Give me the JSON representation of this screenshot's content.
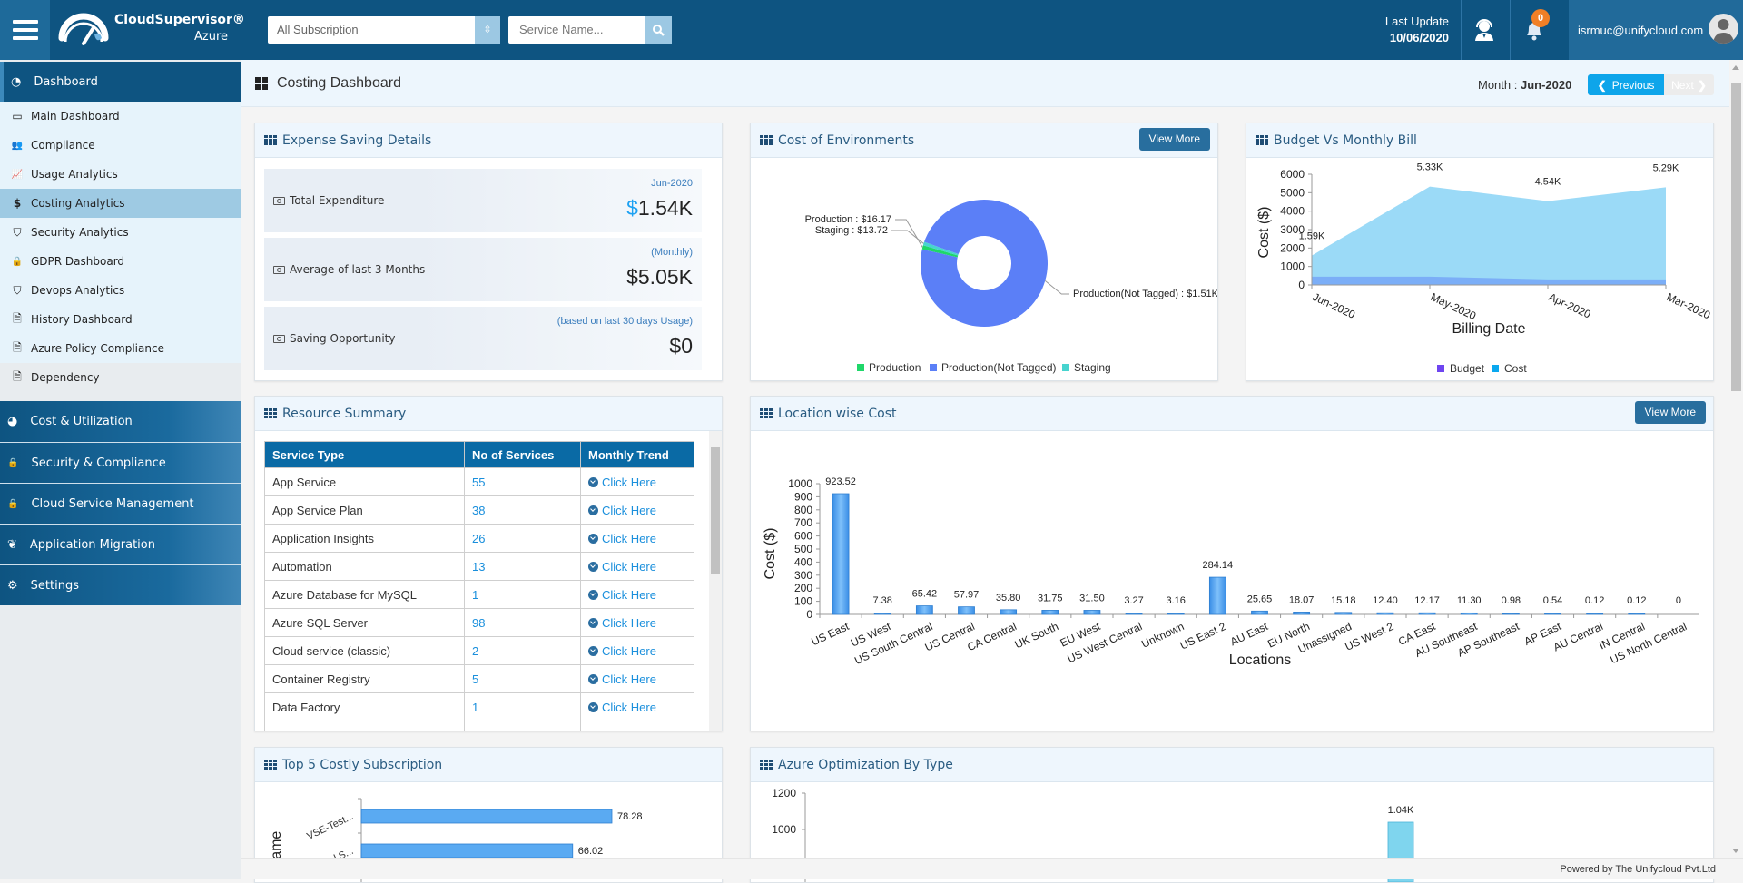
{
  "header": {
    "brand": "CloudSupervisor®",
    "brand_sub": "Azure",
    "subscription_select": "All Subscription",
    "service_search_placeholder": "Service Name...",
    "last_update_label": "Last Update",
    "last_update_value": "10/06/2020",
    "notification_count": "0",
    "user_email": "isrmuc@unifycloud.com"
  },
  "sidebar": {
    "dashboard_label": "Dashboard",
    "sub_items": [
      {
        "label": "Main Dashboard",
        "icon": "monitor-icon",
        "glyph": "▭",
        "active": false
      },
      {
        "label": "Compliance",
        "icon": "users-icon",
        "glyph": "👥",
        "active": false
      },
      {
        "label": "Usage Analytics",
        "icon": "line-chart-icon",
        "glyph": "📈",
        "active": false
      },
      {
        "label": "Costing Analytics",
        "icon": "dollar-icon",
        "glyph": "$",
        "active": true
      },
      {
        "label": "Security Analytics",
        "icon": "shield-icon",
        "glyph": "⛉",
        "active": false
      },
      {
        "label": "GDPR Dashboard",
        "icon": "lock-icon",
        "glyph": "🔒",
        "active": false
      },
      {
        "label": "Devops Analytics",
        "icon": "shield-icon",
        "glyph": "⛉",
        "active": false
      },
      {
        "label": "History Dashboard",
        "icon": "document-icon",
        "glyph": "🗎",
        "active": false
      },
      {
        "label": "Azure Policy Compliance",
        "icon": "document-icon",
        "glyph": "🗎",
        "active": false
      },
      {
        "label": "Dependency",
        "icon": "document-icon",
        "glyph": "🗎",
        "active": false
      }
    ],
    "main_items": [
      {
        "label": "Cost & Utilization",
        "icon": "pie-chart-icon",
        "glyph": "◕"
      },
      {
        "label": "Security & Compliance",
        "icon": "lock-icon",
        "glyph": "🔒"
      },
      {
        "label": "Cloud Service Management",
        "icon": "lock-icon",
        "glyph": "🔒"
      },
      {
        "label": "Application Migration",
        "icon": "leaf-icon",
        "glyph": "❦"
      },
      {
        "label": "Settings",
        "icon": "gear-icon",
        "glyph": "⚙"
      }
    ]
  },
  "page": {
    "title": "Costing Dashboard",
    "month_label": "Month : ",
    "month_value": "Jun-2020",
    "previous_label": "Previous",
    "next_label": "Next"
  },
  "expense": {
    "title": "Expense Saving Details",
    "rows": [
      {
        "label": "Total Expenditure",
        "sub": "Jun-2020",
        "currency": "$",
        "value": "1.54K"
      },
      {
        "label": "Average of last 3 Months",
        "sub": "(Monthly)",
        "currency": "$",
        "value": "5.05K"
      },
      {
        "label": "Saving Opportunity",
        "sub": "(based on last 30 days Usage)",
        "currency": "$",
        "value": "0"
      }
    ]
  },
  "resource_summary": {
    "title": "Resource Summary",
    "columns": [
      "Service Type",
      "No of Services",
      "Monthly Trend"
    ],
    "rows": [
      {
        "service": "App Service",
        "count": "55",
        "trend": "Click Here"
      },
      {
        "service": "App Service Plan",
        "count": "38",
        "trend": "Click Here"
      },
      {
        "service": "Application Insights",
        "count": "26",
        "trend": "Click Here"
      },
      {
        "service": "Automation",
        "count": "13",
        "trend": "Click Here"
      },
      {
        "service": "Azure Database for MySQL",
        "count": "1",
        "trend": "Click Here"
      },
      {
        "service": "Azure SQL Server",
        "count": "98",
        "trend": "Click Here"
      },
      {
        "service": "Cloud service (classic)",
        "count": "2",
        "trend": "Click Here"
      },
      {
        "service": "Container Registry",
        "count": "5",
        "trend": "Click Here"
      },
      {
        "service": "Data Factory",
        "count": "1",
        "trend": "Click Here"
      }
    ]
  },
  "panels": {
    "view_more_label": "View More",
    "top5_title": "Top 5 Costly Subscription",
    "optimization_title": "Azure Optimization By Type"
  },
  "footer": {
    "text": "Powered by The Unifycloud Pvt.Ltd"
  },
  "chart_data": [
    {
      "id": "cost_of_environments",
      "type": "pie",
      "title": "Cost of Environments",
      "labels": [
        "Production",
        "Production(Not Tagged)",
        "Staging"
      ],
      "values": [
        16.17,
        1510,
        13.72
      ],
      "data_labels": [
        "Production : $16.17",
        "Production(Not Tagged) : $1.51K",
        "Staging : $13.72"
      ],
      "colors": [
        "#1fd76a",
        "#5b7ff7",
        "#47d4cf"
      ],
      "donut": true,
      "legend": "bottom"
    },
    {
      "id": "budget_vs_monthly_bill",
      "type": "area",
      "title": "Budget Vs Monthly Bill",
      "categories": [
        "Jun-2020",
        "May-2020",
        "Apr-2020",
        "Mar-2020"
      ],
      "series": [
        {
          "name": "Budget",
          "values": [
            450,
            450,
            300,
            300
          ],
          "color": "#6e45f0"
        },
        {
          "name": "Cost",
          "values": [
            1590,
            5330,
            4540,
            5290
          ],
          "color": "#0aa8ef",
          "data_labels": [
            "1.59K",
            "5.33K",
            "4.54K",
            "5.29K"
          ]
        }
      ],
      "xlabel": "Billing Date",
      "ylabel": "Cost ($)",
      "ylim": [
        0,
        6000
      ],
      "yticks": [
        0,
        1000,
        2000,
        3000,
        4000,
        5000,
        6000
      ],
      "legend": "bottom"
    },
    {
      "id": "location_wise_cost",
      "type": "bar",
      "title": "Location wise Cost",
      "categories": [
        "US East",
        "US West",
        "US South Central",
        "US Central",
        "CA Central",
        "UK South",
        "EU West",
        "US West Central",
        "Unknown",
        "US East 2",
        "AU East",
        "EU North",
        "Unassigned",
        "US West 2",
        "CA East",
        "AU Southeast",
        "AP Southeast",
        "AP East",
        "AU Central",
        "IN Central",
        "US North Central"
      ],
      "values": [
        923.52,
        7.38,
        65.42,
        57.97,
        35.8,
        31.75,
        31.5,
        3.27,
        3.16,
        284.14,
        25.65,
        18.07,
        15.18,
        12.4,
        12.17,
        11.3,
        0.98,
        0.54,
        0.12,
        0.12,
        0
      ],
      "data_labels": [
        "923.52",
        "7.38",
        "65.42",
        "57.97",
        "35.80",
        "31.75",
        "31.50",
        "3.27",
        "3.16",
        "284.14",
        "25.65",
        "18.07",
        "15.18",
        "12.40",
        "12.17",
        "11.30",
        "0.98",
        "0.54",
        "0.12",
        "0.12",
        "0"
      ],
      "xlabel": "Locations",
      "ylabel": "Cost ($)",
      "ylim": [
        0,
        1000
      ],
      "yticks": [
        0,
        100,
        200,
        300,
        400,
        500,
        600,
        700,
        800,
        900,
        1000
      ],
      "color": "#4ba3f0"
    },
    {
      "id": "top5_costly_subscription",
      "type": "bar",
      "orientation": "horizontal",
      "title": "Top 5 Costly Subscription",
      "categories": [
        "VSE-Test...",
        "...l S..."
      ],
      "values": [
        78.28,
        66.02
      ],
      "data_labels": [
        "78.28",
        "66.02"
      ],
      "ylabel": "Name",
      "color": "#4ba3f0"
    },
    {
      "id": "azure_optimization_by_type",
      "type": "bar",
      "title": "Azure Optimization By Type",
      "values": [
        1040
      ],
      "data_labels": [
        "1.04K"
      ],
      "yticks": [
        1000,
        1200
      ],
      "color": "#66cfe8"
    }
  ]
}
